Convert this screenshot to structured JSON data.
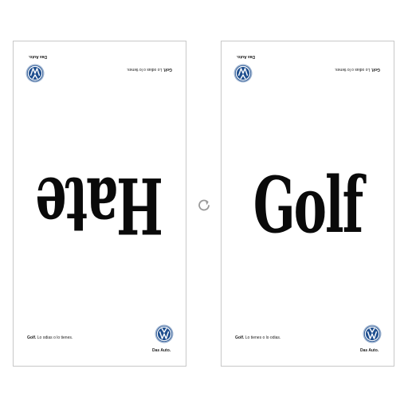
{
  "panels": [
    {
      "word": "Hate",
      "tagline_brand": "Golf.",
      "tagline_text": " Lo odias o lo tienes.",
      "signoff": "Das Auto."
    },
    {
      "word": "Golf",
      "tagline_brand": "Golf.",
      "tagline_text": " Lo tienes o lo odias.",
      "signoff": "Das Auto."
    }
  ],
  "icons": {
    "logo": "vw-logo-icon",
    "rotate": "rotate-icon"
  },
  "colors": {
    "vw_blue": "#1f4f8f",
    "ink": "#0a0a0a",
    "border": "#c8c8c8",
    "icon_gray": "#9a9a9a"
  }
}
